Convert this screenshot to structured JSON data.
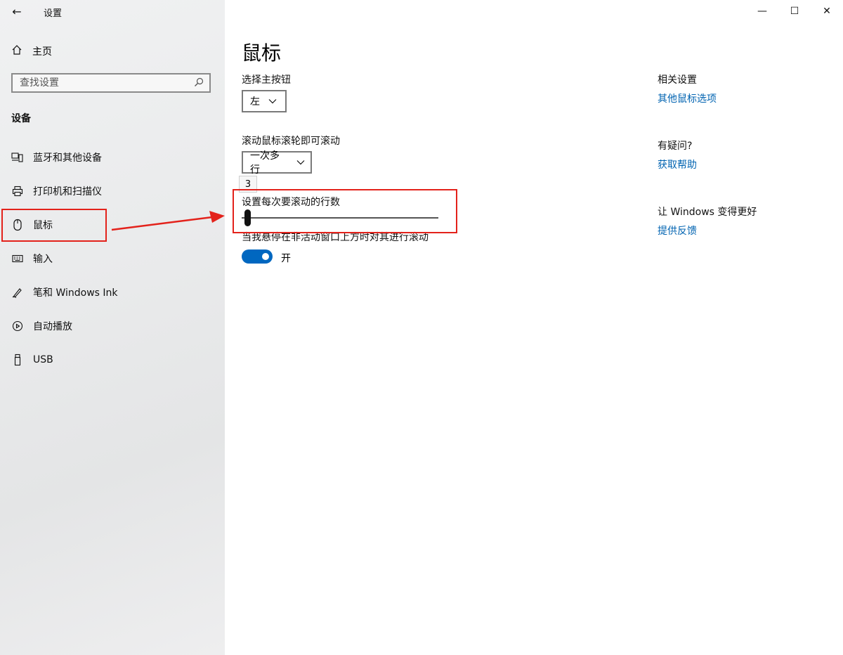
{
  "window": {
    "title": "设置",
    "controls": {
      "minimize": "—",
      "maximize": "☐",
      "close": "✕"
    }
  },
  "sidebar": {
    "back_icon": "←",
    "home_label": "主页",
    "search_placeholder": "查找设置",
    "group_title": "设备",
    "items": [
      {
        "label": "蓝牙和其他设备",
        "icon": "bluetooth-devices-icon"
      },
      {
        "label": "打印机和扫描仪",
        "icon": "printer-icon"
      },
      {
        "label": "鼠标",
        "icon": "mouse-icon"
      },
      {
        "label": "输入",
        "icon": "keyboard-icon"
      },
      {
        "label": "笔和 Windows Ink",
        "icon": "pen-icon"
      },
      {
        "label": "自动播放",
        "icon": "autoplay-icon"
      },
      {
        "label": "USB",
        "icon": "usb-icon"
      }
    ]
  },
  "main": {
    "title": "鼠标",
    "primary_button": {
      "label": "选择主按钮",
      "value": "左"
    },
    "wheel": {
      "label": "滚动鼠标滚轮即可滚动",
      "value": "一次多行"
    },
    "lines": {
      "tooltip": "3",
      "label": "设置每次要滚动的行数",
      "value": 3,
      "min": 1,
      "max": 100
    },
    "inactive_scroll": {
      "label": "当我悬停在非活动窗口上方时对其进行滚动",
      "state": "开",
      "on": true
    }
  },
  "related": {
    "related_settings": {
      "title": "相关设置",
      "link": "其他鼠标选项"
    },
    "questions": {
      "title": "有疑问?",
      "link": "获取帮助"
    },
    "feedback": {
      "title": "让 Windows 变得更好",
      "link": "提供反馈"
    }
  },
  "colors": {
    "accent": "#0067c0",
    "link": "#0063b1",
    "annotation": "#e3221b"
  }
}
